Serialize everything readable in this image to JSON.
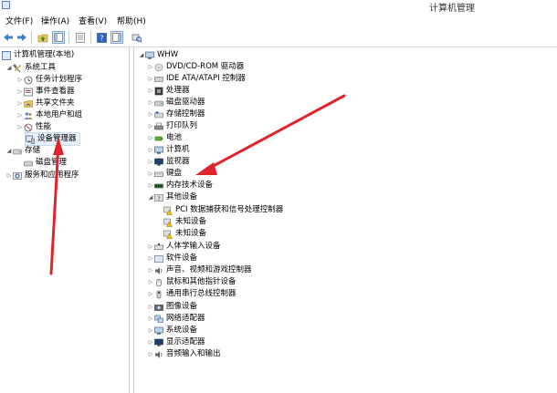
{
  "window": {
    "title": "计算机管理"
  },
  "menu": [
    {
      "label": "文件(F)"
    },
    {
      "label": "操作(A)"
    },
    {
      "label": "查看(V)"
    },
    {
      "label": "帮助(H)"
    }
  ],
  "left_tree": {
    "root": "计算机管理(本地)",
    "system_tools": "系统工具",
    "task_scheduler": "任务计划程序",
    "event_viewer": "事件查看器",
    "shared_folders": "共享文件夹",
    "local_users": "本地用户和组",
    "performance": "性能",
    "device_manager": "设备管理器",
    "storage": "存储",
    "disk_management": "磁盘管理",
    "services": "服务和应用程序"
  },
  "right_tree": {
    "root": "WHW",
    "items": [
      {
        "label": "DVD/CD-ROM 驱动器"
      },
      {
        "label": "IDE ATA/ATAPI 控制器"
      },
      {
        "label": "处理器"
      },
      {
        "label": "磁盘驱动器"
      },
      {
        "label": "存储控制器"
      },
      {
        "label": "打印队列"
      },
      {
        "label": "电池"
      },
      {
        "label": "计算机"
      },
      {
        "label": "监视器"
      },
      {
        "label": "键盘"
      },
      {
        "label": "内存技术设备"
      },
      {
        "label": "其他设备"
      }
    ],
    "other_children": [
      {
        "label": "PCI 数据捕获和信号处理控制器"
      },
      {
        "label": "未知设备"
      },
      {
        "label": "未知设备"
      }
    ],
    "items2": [
      {
        "label": "人体学输入设备"
      },
      {
        "label": "软件设备"
      },
      {
        "label": "声音、视频和游戏控制器"
      },
      {
        "label": "鼠标和其他指针设备"
      },
      {
        "label": "通用串行总线控制器"
      },
      {
        "label": "图像设备"
      },
      {
        "label": "网络适配器"
      },
      {
        "label": "系统设备"
      },
      {
        "label": "显示适配器"
      },
      {
        "label": "音频输入和输出"
      }
    ]
  },
  "colors": {
    "arrow": "#e0242b",
    "selection": "#e5f0fb"
  }
}
